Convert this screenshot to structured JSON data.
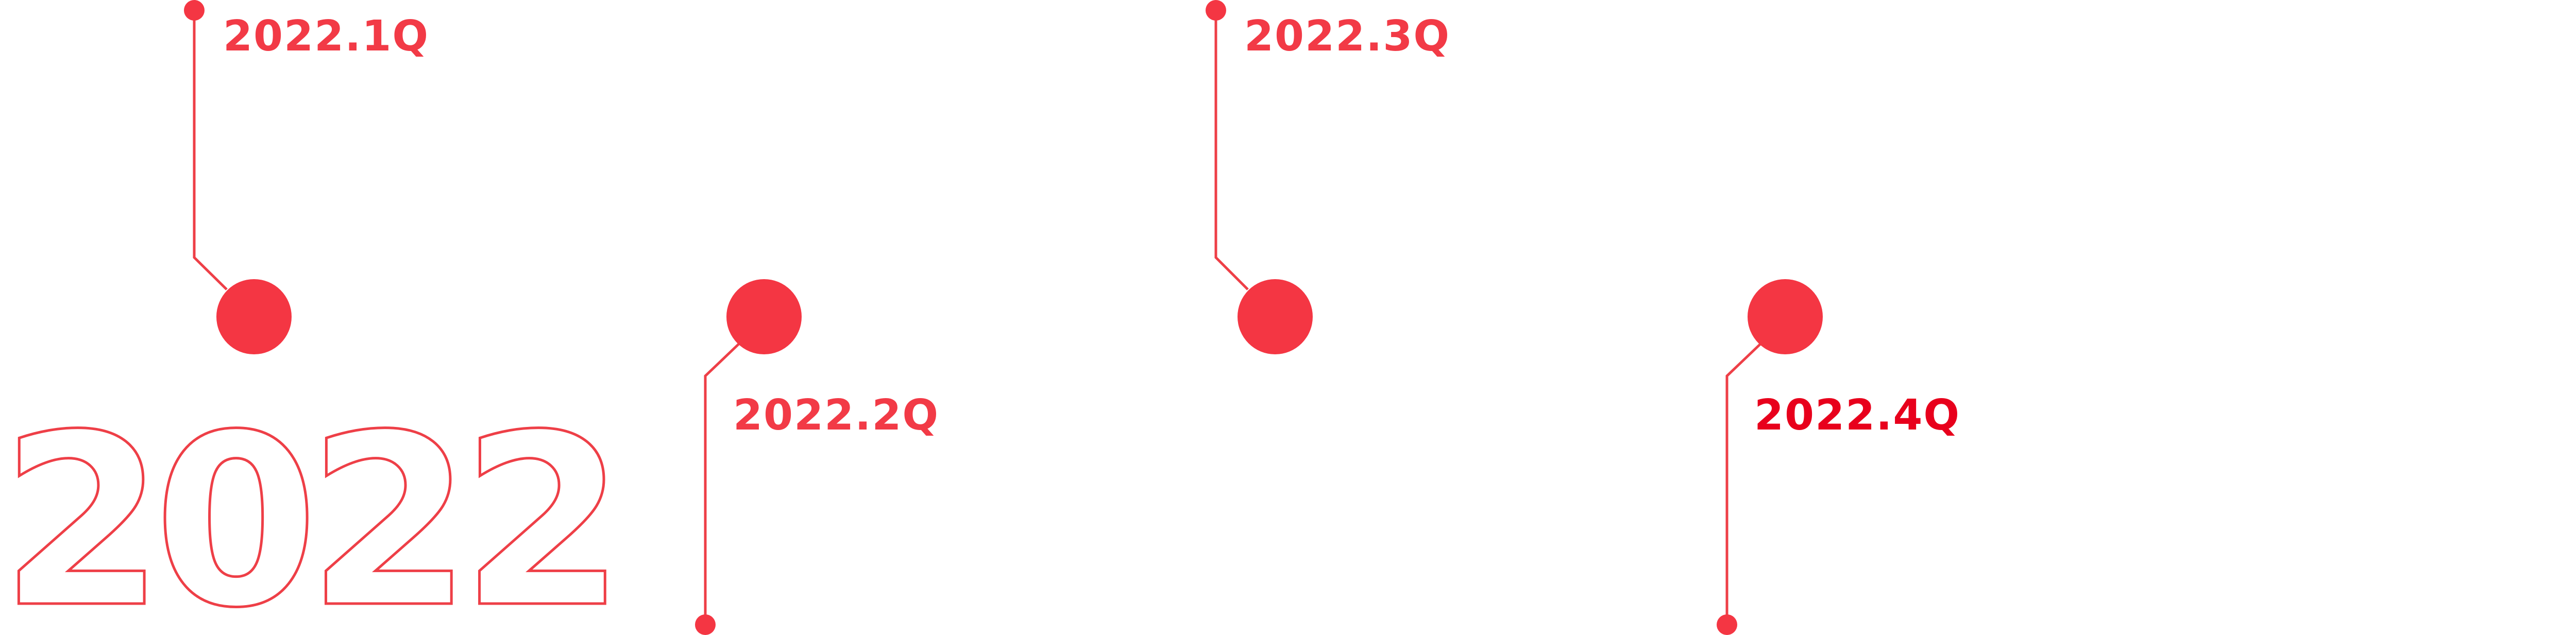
{
  "year_label": "2022",
  "milestones": [
    {
      "label": "2022.1Q",
      "color": "#f23a46"
    },
    {
      "label": "2022.2Q",
      "color": "#f23a46"
    },
    {
      "label": "2022.3Q",
      "color": "#f23a46"
    },
    {
      "label": "2022.4Q",
      "color": "#e8001c"
    }
  ],
  "colors": {
    "accent": "#f43643",
    "line": "#ee3f47",
    "background": "#ffffff"
  }
}
